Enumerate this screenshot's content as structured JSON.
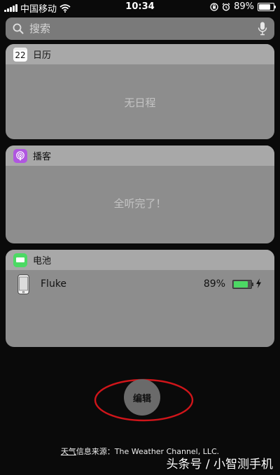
{
  "status_bar": {
    "carrier": "中国移动",
    "time": "10:34",
    "battery_percent": "89%",
    "battery_level": 0.89
  },
  "search": {
    "placeholder": "搜索",
    "icon": "search-icon",
    "mic_icon": "microphone-icon"
  },
  "widgets": [
    {
      "id": "calendar",
      "title": "日历",
      "icon": "calendar-icon",
      "icon_text": "22",
      "empty_text": "无日程"
    },
    {
      "id": "podcasts",
      "title": "播客",
      "icon": "podcast-icon",
      "empty_text": "全听完了！"
    },
    {
      "id": "batteries",
      "title": "电池",
      "icon": "battery-widget-icon",
      "devices": [
        {
          "name": "Fluke",
          "percent": "89%",
          "level": 0.89,
          "charging": true
        }
      ]
    }
  ],
  "edit_button": {
    "label": "编辑"
  },
  "footer": {
    "weather_link": "天气",
    "weather_text": "信息来源：The Weather Channel, LLC."
  },
  "watermark": "头条号 / 小智测手机",
  "colors": {
    "background": "#0a0a0a",
    "widget_body": "#8d8d8d",
    "widget_header": "#a8a8a8",
    "podcast_purple": "#b056e0",
    "battery_green": "#4cd964",
    "annotation_red": "#d0151a"
  }
}
